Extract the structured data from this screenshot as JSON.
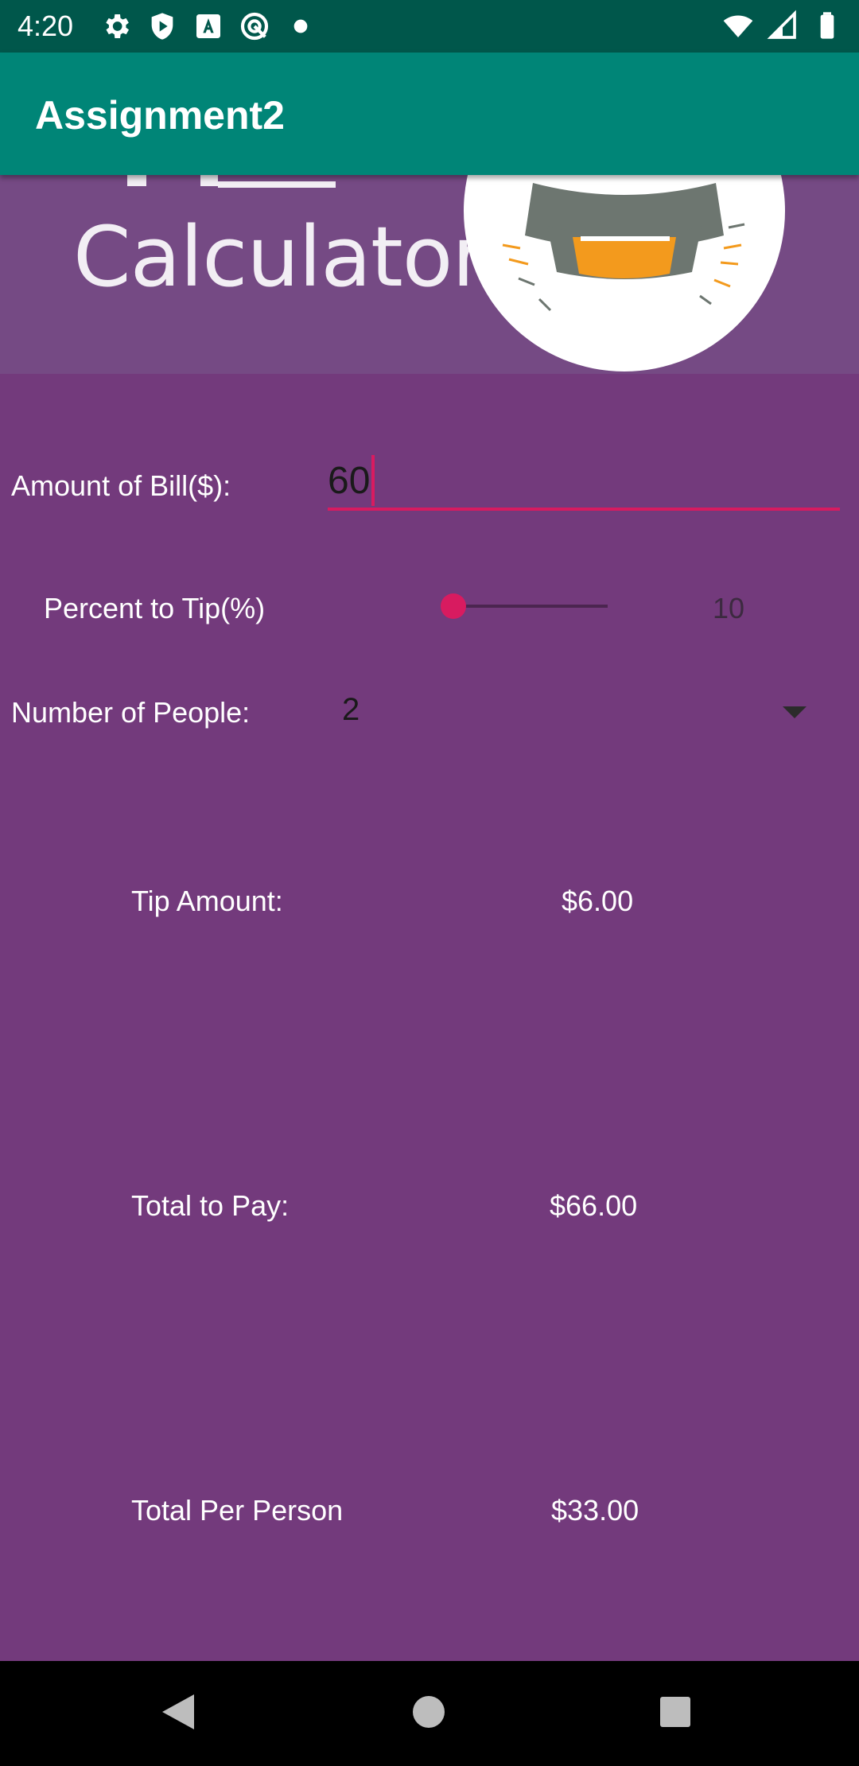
{
  "status_bar": {
    "time": "4:20",
    "left_icons": [
      "gear-icon",
      "shield-play-icon",
      "a-box-icon",
      "target-icon",
      "dot-icon"
    ],
    "right_icons": [
      "wifi-icon",
      "signal-icon",
      "battery-icon"
    ]
  },
  "app_bar": {
    "title": "Assignment2"
  },
  "banner": {
    "text": "Calculator"
  },
  "form": {
    "bill_label": "Amount of Bill($):",
    "bill_value": "60",
    "tip_label": "Percent to Tip(%)",
    "tip_value": "10",
    "tip_percent_level": 0.1,
    "people_label": "Number of People:",
    "people_value": "2"
  },
  "results": {
    "tip_amount_label": "Tip Amount:",
    "tip_amount_value": "$6.00",
    "total_label": "Total to Pay:",
    "total_value": "$66.00",
    "per_person_label": "Total Per Person",
    "per_person_value": "$33.00"
  },
  "colors": {
    "status_bar": "#00574b",
    "app_bar": "#008577",
    "background": "#733a7c",
    "accent": "#d81b60"
  },
  "nav_bar": {
    "icons": [
      "back-icon",
      "home-icon",
      "recents-icon"
    ]
  }
}
